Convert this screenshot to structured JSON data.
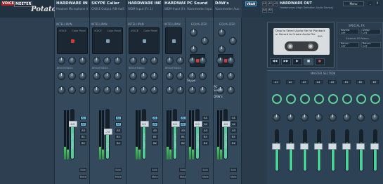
{
  "app": {
    "logo_tag1": "VOICE",
    "logo_tag2": "MEETER",
    "logo_name": "Potato"
  },
  "hardware_inputs": [
    {
      "title": "HARDWARE INPUT 1",
      "sub": "Headset Microphone (Logitec...",
      "intel": "INTELLIPAN",
      "scope_labels": [
        "VOICE",
        "Color Panel"
      ],
      "fx_label": "BRIGHTNESS",
      "fader_value": "-0.0",
      "fader_label": "Fader Gain"
    },
    {
      "title": "SKYPE Caller",
      "sub": "CABLE Output (VB-Audio Virt...",
      "intel": "INTELLIPAN",
      "scope_labels": [
        "VOICE",
        "Color Panel"
      ],
      "fx_label": "BRIGHTNESS",
      "fader_value": "-7.0",
      "fader_label": "SKYPE Caller"
    },
    {
      "title": "HARDWARE INPUT 3",
      "sub": "WDM-Input (Fx 1)",
      "intel": "INTELLIPAN",
      "scope_labels": [
        "VOICE",
        "Color Panel"
      ],
      "fx_label": "BRIGHTNESS",
      "fader_value": "0.0",
      "fader_label": "Fader Gain"
    },
    {
      "title": "HARDWARE INPUT 4",
      "sub": "WDM-Input (Fx 1)",
      "intel": "INTELLIPAN",
      "scope_labels": [
        "VOICE",
        "Color Panel"
      ],
      "fx_label": "BRIGHTNESS",
      "fader_value": "0.0",
      "fader_label": "Fader Gain"
    },
    {
      "title": "HARDWARE INPUT 5",
      "sub": "WDM-Input (Fx 1)",
      "intel": "INTELLIPAN",
      "scope_labels": [
        "VOICE",
        "Color Panel"
      ],
      "fx_label": "BRIGHTNESS",
      "fader_value": "0.0",
      "fader_label": "Fader Gain"
    }
  ],
  "virtual_inputs": [
    {
      "title": "PC Sound",
      "sub": "Voicemeeter Input (VB-Audio...",
      "eq": "EQUALIZER",
      "fader_value": "0.0",
      "fader_label": "Fader Gain"
    },
    {
      "title": "DAW's",
      "sub": "Voicemeeter Aux Input (VB-Au...",
      "eq": "EQUALIZER",
      "fader_value": "-0.0",
      "fader_label": "Fader Gain"
    }
  ],
  "virtual_list": [
    "Skype",
    "PC Sound",
    "DAW's"
  ],
  "topbar": {
    "vban": "VBAN",
    "a1": "A1",
    "a2": "A2",
    "a3": "A3",
    "a4": "A4",
    "a5": "A5",
    "hw_out_title": "HARDWARE OUT",
    "hw_out_sub": "Headphones (High Definition Audio Device)",
    "menu": "Menu",
    "minimize": "_",
    "close": "X"
  },
  "player": {
    "tape_text": "Drop to Select Audio file for Playback or Record to Create Audio File",
    "counter": "000",
    "controls": [
      "◀◀",
      "▶▶",
      "▶",
      "■",
      "●"
    ]
  },
  "special": {
    "title": "SPECIAL FX",
    "buttons": [
      {
        "top": "Reverb",
        "bottom": "OFF"
      },
      {
        "top": "Delay",
        "bottom": "OFF"
      },
      {
        "top": "Return",
        "bottom": "OFF"
      },
      {
        "top": "Return",
        "bottom": "OFF"
      }
    ],
    "ext": "External FX Return"
  },
  "master": {
    "title": "MASTER SECTION",
    "buses": [
      "A1",
      "A2",
      "A3",
      "A4",
      "A5",
      "B1",
      "B2",
      "B3"
    ]
  },
  "common": {
    "mute": "Mute",
    "solo": "Solo",
    "mono": "Mono",
    "comp": "Comp",
    "gate": "Gate",
    "denoiser": "Denoiser"
  }
}
